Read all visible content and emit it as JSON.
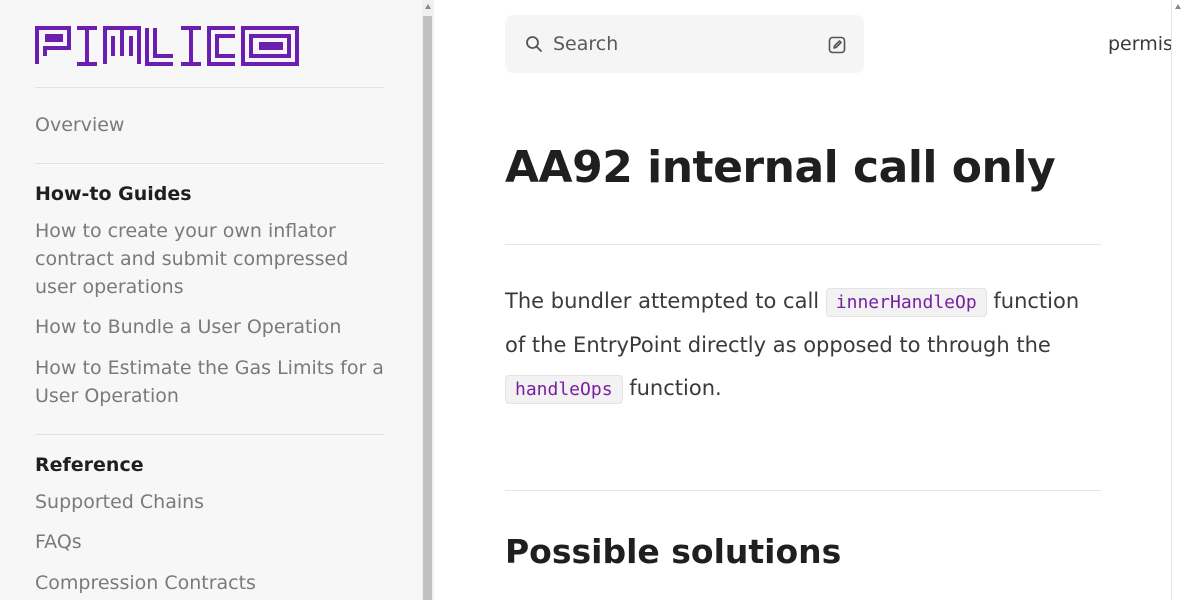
{
  "brand": {
    "logo_text": "PIMLICO",
    "color": "#6a1fb0"
  },
  "sidebar": {
    "overview": "Overview",
    "sections": [
      {
        "heading": "How-to Guides",
        "items": [
          "How to create your own inflator contract and submit compressed user operations",
          "How to Bundle a User Operation",
          "How to Estimate the Gas Limits for a User Operation"
        ]
      },
      {
        "heading": "Reference",
        "items": [
          "Supported Chains",
          "FAQs",
          "Compression Contracts"
        ]
      }
    ]
  },
  "search": {
    "placeholder": "Search"
  },
  "header": {
    "top_link": "permis"
  },
  "content": {
    "title": "AA92 internal call only",
    "paragraph": {
      "text_1": "The bundler attempted to call ",
      "code_1": "innerHandleOp",
      "text_2": " function of the EntryPoint directly as opposed to through the ",
      "code_2": "handleOps",
      "text_3": " function."
    },
    "section_heading": "Possible solutions"
  }
}
